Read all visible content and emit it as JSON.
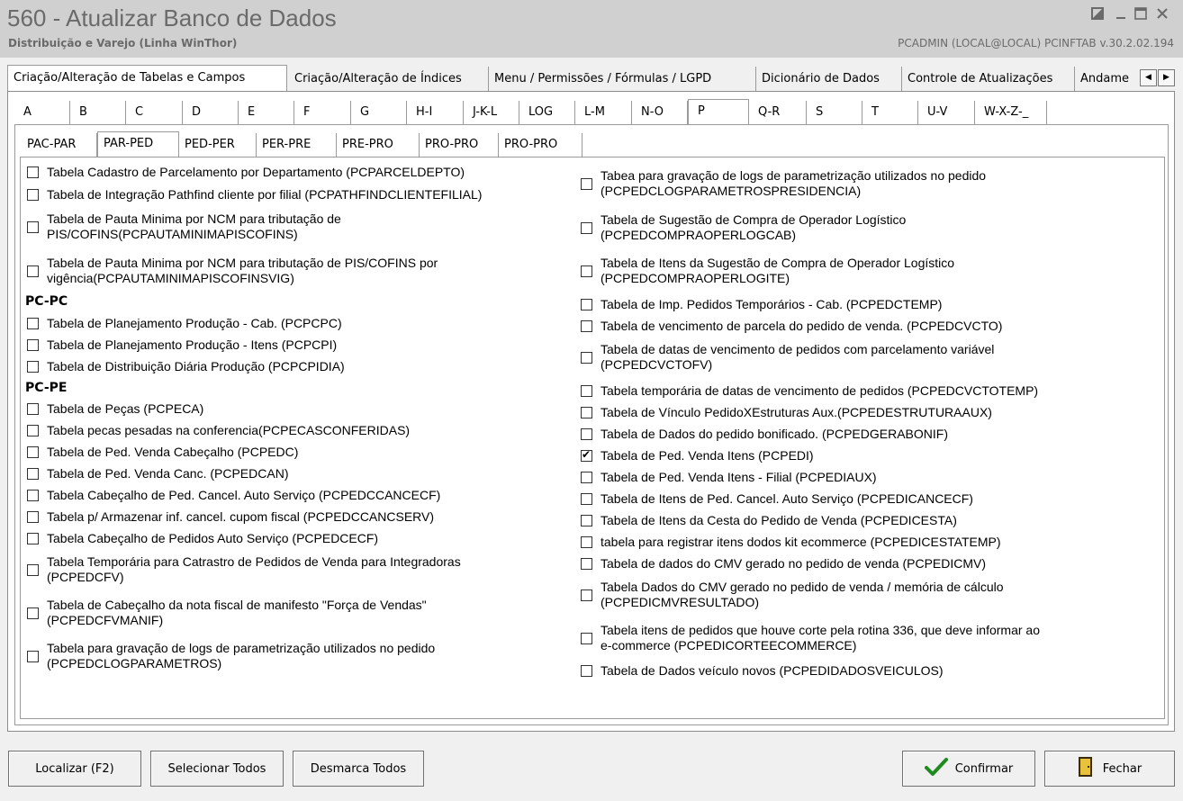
{
  "window": {
    "title": "560 - Atualizar Banco de Dados",
    "subtitle": "Distribuição e Varejo (Linha WinThor)",
    "user_info": "PCADMIN (LOCAL@LOCAL)  PCINFTAB  v.30.2.02.194",
    "controls": [
      "restore-icon",
      "minimize-icon",
      "maximize-icon",
      "close-icon"
    ]
  },
  "main_tabs": [
    "Criação/Alteração de Tabelas e Campos",
    "Criação/Alteração de Índices",
    "Menu / Permissões / Fórmulas / LGPD",
    "Dicionário de Dados",
    "Controle de Atualizações",
    "Andame"
  ],
  "letter_tabs": [
    "A",
    "B",
    "C",
    "D",
    "E",
    "F",
    "G",
    "H-I",
    "J-K-L",
    "LOG",
    "L-M",
    "N-O",
    "P",
    "Q-R",
    "S",
    "T",
    "U-V",
    "W-X-Z-_"
  ],
  "sub_tabs": [
    "PAC-PAR",
    "PAR-PED",
    "PED-PER",
    "PER-PRE",
    "PRE-PRO",
    "PRO-PRO",
    "PRO-PRO"
  ],
  "left_column": {
    "items_top": [
      {
        "label": "Tabela Cadastro de Parcelamento por Departamento (PCPARCELDEPTO)",
        "checked": false
      },
      {
        "label": "Tabela de Integração Pathfind cliente por filial (PCPATHFINDCLIENTEFILIAL)",
        "checked": false
      },
      {
        "label": "Tabela de Pauta Minima por NCM para tributação de\nPIS/COFINS(PCPAUTAMINIMAPISCOFINS)",
        "checked": false
      },
      {
        "label": "Tabela de Pauta Minima por NCM para tributação de PIS/COFINS por\nvigência(PCPAUTAMINIMAPISCOFINSVIG)",
        "checked": false
      }
    ],
    "section_pcpc": "PC-PC",
    "items_pcpc": [
      {
        "label": "Tabela de Planejamento Produção - Cab. (PCPCPC)",
        "checked": false
      },
      {
        "label": "Tabela de Planejamento Produção - Itens (PCPCPI)",
        "checked": false
      },
      {
        "label": "Tabela de Distribuição Diária Produção (PCPCPIDIA)",
        "checked": false
      }
    ],
    "section_pcpe": "PC-PE",
    "items_pcpe": [
      {
        "label": "Tabela de Peças (PCPECA)",
        "checked": false
      },
      {
        "label": "Tabela pecas pesadas na conferencia(PCPECASCONFERIDAS)",
        "checked": false
      },
      {
        "label": "Tabela de Ped. Venda Cabeçalho (PCPEDC)",
        "checked": false
      },
      {
        "label": "Tabela de Ped. Venda Canc. (PCPEDCAN)",
        "checked": false
      },
      {
        "label": "Tabela Cabeçalho de Ped. Cancel. Auto Serviço (PCPEDCCANCECF)",
        "checked": false
      },
      {
        "label": "Tabela p/ Armazenar inf. cancel. cupom fiscal (PCPEDCCANCSERV)",
        "checked": false
      },
      {
        "label": "Tabela Cabeçalho de Pedidos Auto Serviço (PCPEDCECF)",
        "checked": false
      },
      {
        "label": "Tabela Temporária para Catrastro de Pedidos de Venda para Integradoras\n(PCPEDCFV)",
        "checked": false
      },
      {
        "label": "Tabela de Cabeçalho da nota fiscal de manifesto \"Força de Vendas\"\n(PCPEDCFVMANIF)",
        "checked": false
      },
      {
        "label": "Tabela para gravação de logs de parametrização utilizados no pedido\n(PCPEDCLOGPARAMETROS)",
        "checked": false
      }
    ]
  },
  "right_column": [
    {
      "label": "Tabea para gravação de logs de parametrização utilizados no pedido\n(PCPEDCLOGPARAMETROSPRESIDENCIA)",
      "checked": false
    },
    {
      "label": "Tabela de Sugestão de Compra de Operador Logístico\n(PCPEDCOMPRAOPERLOGCAB)",
      "checked": false
    },
    {
      "label": "Tabela de Itens da Sugestão de Compra de Operador Logístico\n(PCPEDCOMPRAOPERLOGITE)",
      "checked": false
    },
    {
      "label": "Tabela de Imp. Pedidos Temporários - Cab. (PCPEDCTEMP)",
      "checked": false
    },
    {
      "label": "Tabela de vencimento de parcela do pedido de venda. (PCPEDCVCTO)",
      "checked": false
    },
    {
      "label": "Tabela de datas de vencimento de pedidos com parcelamento variável\n(PCPEDCVCTOFV)",
      "checked": false
    },
    {
      "label": "Tabela temporária de datas de vencimento de pedidos  (PCPEDCVCTOTEMP)",
      "checked": false
    },
    {
      "label": "Tabela de Vínculo PedidoXEstruturas Aux.(PCPEDESTRUTURAAUX)",
      "checked": false
    },
    {
      "label": "Tabela de Dados do pedido bonificado. (PCPEDGERABONIF)",
      "checked": false
    },
    {
      "label": "Tabela de Ped. Venda Itens (PCPEDI)",
      "checked": true
    },
    {
      "label": "Tabela de Ped. Venda Itens - Filial (PCPEDIAUX)",
      "checked": false
    },
    {
      "label": "Tabela de Itens de Ped. Cancel. Auto Serviço (PCPEDICANCECF)",
      "checked": false
    },
    {
      "label": "Tabela de Itens da Cesta do Pedido de Venda (PCPEDICESTA)",
      "checked": false
    },
    {
      "label": "tabela para registrar itens dodos kit ecommerce (PCPEDICESTATEMP)",
      "checked": false
    },
    {
      "label": "Tabela de dados do CMV gerado no pedido de venda (PCPEDICMV)",
      "checked": false
    },
    {
      "label": "Tabela Dados do CMV gerado no pedido de venda / memória de cálculo\n(PCPEDICMVRESULTADO)",
      "checked": false
    },
    {
      "label": "Tabela itens de pedidos que houve corte pela rotina 336, que deve informar ao\ne-commerce (PCPEDICORTEECOMMERCE)",
      "checked": false
    },
    {
      "label": "Tabela de Dados veículo novos (PCPEDIDADOSVEICULOS)",
      "checked": false
    }
  ],
  "buttons": {
    "localizar": "Localizar (F2)",
    "selecionar_todos": "Selecionar Todos",
    "desmarca_todos": "Desmarca Todos",
    "confirmar": "Confirmar",
    "fechar": "Fechar"
  }
}
